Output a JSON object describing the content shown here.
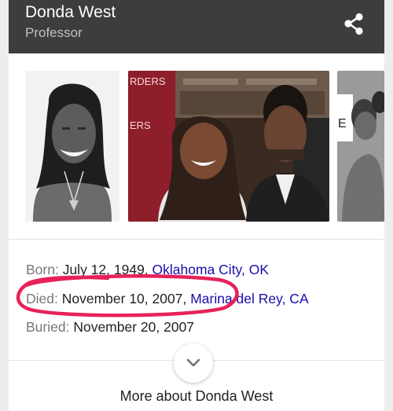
{
  "header": {
    "title": "Donda West",
    "subtitle": "Professor",
    "share_icon": "share-icon"
  },
  "colors": {
    "header_bg": "#3d3d3d",
    "link": "#1a0dab",
    "label": "#777777",
    "annotation": "#e8215a"
  },
  "images": [
    {
      "name": "portrait-photo",
      "sign_text": ""
    },
    {
      "name": "event-photo",
      "sign_text": "RDERS ERS"
    },
    {
      "name": "cropped-photo",
      "sign_text": "E"
    }
  ],
  "facts": {
    "born": {
      "label": "Born:",
      "date": "July 12, 1949,",
      "place": "Oklahoma City, OK"
    },
    "died": {
      "label": "Died:",
      "date": "November 10, 2007,",
      "place": "Marina del Rey, CA"
    },
    "buried": {
      "label": "Buried:",
      "date": "November 20, 2007"
    }
  },
  "footer": {
    "expand_icon": "chevron-down-icon",
    "more_label": "More about Donda West"
  }
}
